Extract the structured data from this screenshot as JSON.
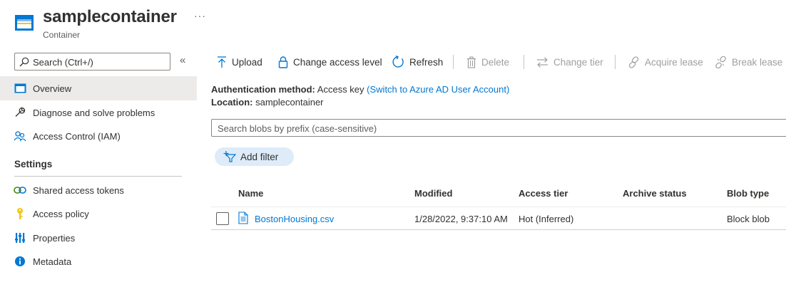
{
  "header": {
    "title": "samplecontainer",
    "subtitle": "Container",
    "more_label": "···"
  },
  "sidebar": {
    "search_placeholder": "Search (Ctrl+/)",
    "collapse_label": "«",
    "items": [
      {
        "label": "Overview",
        "icon": "container-icon",
        "active": true
      },
      {
        "label": "Diagnose and solve problems",
        "icon": "wrench-icon"
      },
      {
        "label": "Access Control (IAM)",
        "icon": "people-icon"
      }
    ],
    "settings_heading": "Settings",
    "settings_items": [
      {
        "label": "Shared access tokens",
        "icon": "link-icon"
      },
      {
        "label": "Access policy",
        "icon": "key-icon"
      },
      {
        "label": "Properties",
        "icon": "properties-icon"
      },
      {
        "label": "Metadata",
        "icon": "info-icon"
      }
    ]
  },
  "toolbar": {
    "upload": "Upload",
    "change_access_level": "Change access level",
    "refresh": "Refresh",
    "delete": "Delete",
    "change_tier": "Change tier",
    "acquire_lease": "Acquire lease",
    "break_lease": "Break lease"
  },
  "info": {
    "auth_label": "Authentication method:",
    "auth_value": "Access key",
    "auth_link": "(Switch to Azure AD User Account)",
    "location_label": "Location:",
    "location_value": "samplecontainer"
  },
  "blob_search": {
    "placeholder": "Search blobs by prefix (case-sensitive)"
  },
  "filter": {
    "label": "Add filter"
  },
  "table": {
    "columns": [
      "Name",
      "Modified",
      "Access tier",
      "Archive status",
      "Blob type"
    ],
    "rows": [
      {
        "name": "BostonHousing.csv",
        "modified": "1/28/2022, 9:37:10 AM",
        "access_tier": "Hot (Inferred)",
        "archive_status": "",
        "blob_type": "Block blob"
      }
    ]
  },
  "colors": {
    "accent": "#0078d4",
    "active_nav": "#edebe9",
    "filter_pill": "#deecf9"
  }
}
